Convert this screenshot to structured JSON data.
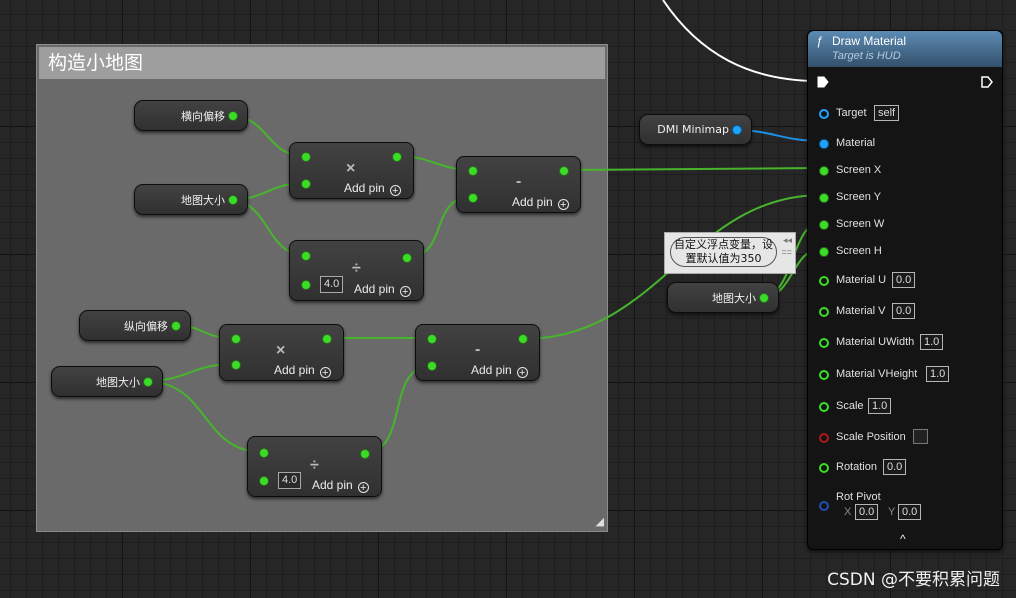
{
  "comment": {
    "title": "构造小地图"
  },
  "variables": {
    "horizontal_offset": "横向偏移",
    "map_size": "地图大小",
    "vertical_offset": "纵向偏移",
    "dmi_minimap": "DMI Minimap"
  },
  "operators": {
    "multiply_symbol": "×",
    "subtract_symbol": "-",
    "divide_symbol": "÷",
    "add_pin_label": "Add pin",
    "add_pin_icon": "+",
    "divide_default": "4.0"
  },
  "tooltip": {
    "text": "自定义浮点变量，设置默认值为350"
  },
  "draw_material": {
    "func_icon": "ƒ",
    "title": "Draw Material",
    "subtitle": "Target is HUD",
    "pins": {
      "target_label": "Target",
      "target_value": "self",
      "material_label": "Material",
      "screen_x_label": "Screen X",
      "screen_y_label": "Screen Y",
      "screen_w_label": "Screen W",
      "screen_h_label": "Screen H",
      "material_u_label": "Material U",
      "material_u_value": "0.0",
      "material_v_label": "Material V",
      "material_v_value": "0.0",
      "material_uwidth_label": "Material UWidth",
      "material_uwidth_value": "1.0",
      "material_vheight_label": "Material VHeight",
      "material_vheight_value": "1.0",
      "scale_label": "Scale",
      "scale_value": "1.0",
      "scale_position_label": "Scale Position",
      "rotation_label": "Rotation",
      "rotation_value": "0.0",
      "rot_pivot_label": "Rot Pivot",
      "rot_pivot_x_label": "X",
      "rot_pivot_x_value": "0.0",
      "rot_pivot_y_label": "Y",
      "rot_pivot_y_value": "0.0"
    },
    "collapse_icon": "^"
  },
  "watermark": "CSDN @不要积累问题",
  "colors": {
    "float_pin": "#3bdc25",
    "object_pin": "#1ea4ff",
    "exec_wire": "#ffffff",
    "header_blue": "#5c8bb3",
    "comment_bg": "#6a6a6a"
  }
}
